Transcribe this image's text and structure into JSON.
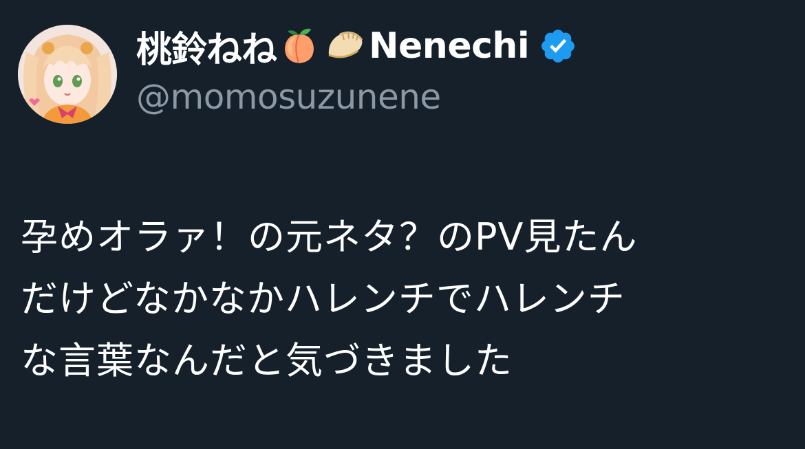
{
  "author": {
    "display_name": "桃鈴ねね",
    "name_emojis": [
      "peach-emoji",
      "dumpling-emoji"
    ],
    "nickname": "Nenechi",
    "verified": true,
    "handle": "@momosuzunene"
  },
  "tweet": {
    "lines": [
      "孕めオラァ！の元ネタ？のPV見たん",
      "だけどなかなかハレンチでハレンチ",
      "な言葉なんだと気づきました"
    ]
  },
  "colors": {
    "background": "#15202b",
    "text": "#ffffff",
    "secondary_text": "#8b98a5",
    "verified_badge": "#1d9bf0"
  }
}
